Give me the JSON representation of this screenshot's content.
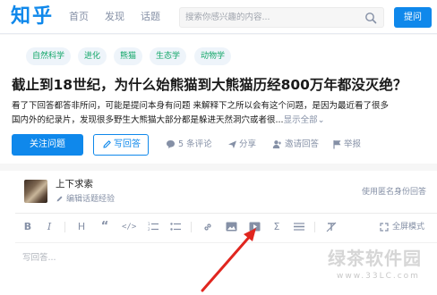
{
  "header": {
    "logo": "知乎",
    "nav": [
      "首页",
      "发现",
      "话题"
    ],
    "search_placeholder": "搜索你感兴趣的内容...",
    "ask_label": "提问"
  },
  "question": {
    "topics": [
      "自然科学",
      "进化",
      "熊猫",
      "生态学",
      "动物学"
    ],
    "title": "截止到18世纪，为什么始熊猫到大熊猫历经800万年都没灭绝？",
    "desc_line1": "看了下回答都答非所问，可能是提问本身有问题 来解释下之所以会有这个问题，是因为最近看了很多",
    "desc_line2": "国内外的纪录片，发现很多野生大熊猫大部分都是躲进天然洞穴或者很...",
    "show_all": "显示全部",
    "follow_label": "关注问题",
    "write_label": "写回答",
    "comments_label": "5 条评论",
    "share_label": "分享",
    "invite_label": "邀请回答",
    "report_label": "举报"
  },
  "editor": {
    "username": "上下求索",
    "edit_bio_label": "编辑话题经验",
    "anonymous_label": "使用匿名身份回答",
    "fullscreen_label": "全屏模式",
    "answer_placeholder": "写回答..."
  },
  "watermark": {
    "main": "绿茶软件园",
    "sub": "www.33LC.com"
  },
  "colors": {
    "brand": "#0f88eb",
    "topic_text": "#11a668",
    "annotation_arrow": "#e0261f"
  }
}
